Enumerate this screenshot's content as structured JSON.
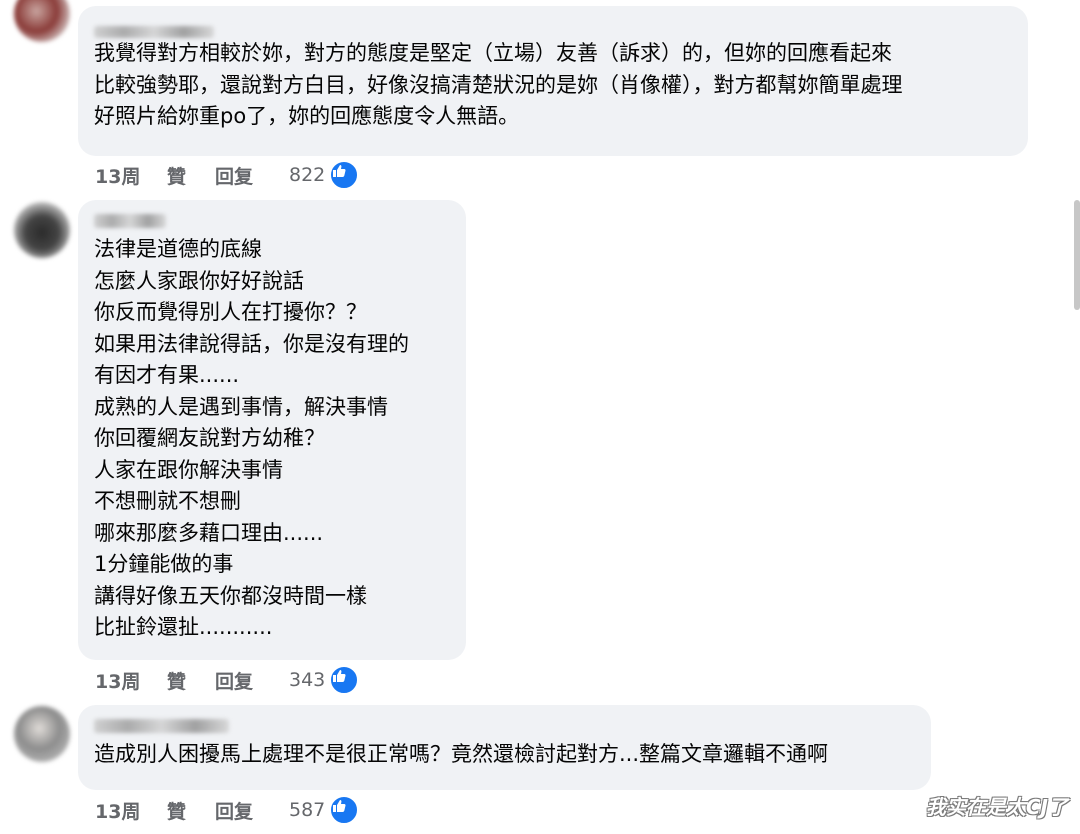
{
  "comments": [
    {
      "text": "我覺得對方相較於妳，對方的態度是堅定（立場）友善（訴求）的，但妳的回應看起來\n比較強勢耶，還說對方白目，好像沒搞清楚狀況的是妳（肖像權），對方都幫妳簡單處理\n好照片給妳重po了，妳的回應態度令人無語。",
      "time": "13周",
      "like": "贊",
      "reply": "回复",
      "reactions": "822"
    },
    {
      "text": "法律是道德的底線\n怎麼人家跟你好好說話\n你反而覺得別人在打擾你？？\n如果用法律說得話，你是沒有理的\n有因才有果......\n成熟的人是遇到事情，解決事情\n你回覆網友說對方幼稚？\n人家在跟你解決事情\n不想刪就不想刪\n哪來那麼多藉口理由......\n1分鐘能做的事\n講得好像五天你都沒時間一樣\n比扯鈴還扯...........",
      "time": "13周",
      "like": "贊",
      "reply": "回复",
      "reactions": "343"
    },
    {
      "text": "造成別人困擾馬上處理不是很正常嗎？竟然還檢討起對方...整篇文章邏輯不通啊",
      "time": "13周",
      "like": "贊",
      "reply": "回复",
      "reactions": "587"
    }
  ],
  "watermark": "我实在是太CJ了",
  "colors": {
    "bubble": "#f0f2f5",
    "meta": "#65676b",
    "like_blue": "#1877f2"
  },
  "icons": {
    "reaction": "thumbs-up-icon"
  }
}
